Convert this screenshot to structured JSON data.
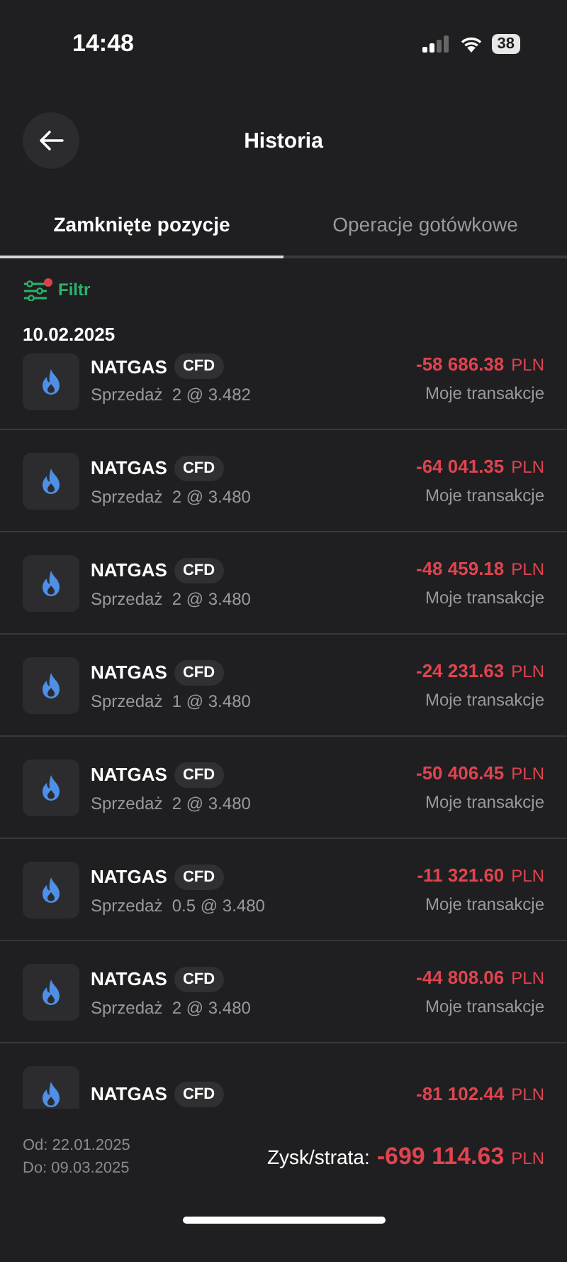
{
  "status_bar": {
    "time": "14:48",
    "battery": "38"
  },
  "header": {
    "title": "Historia"
  },
  "tabs": [
    {
      "label": "Zamknięte pozycje",
      "selected": true
    },
    {
      "label": "Operacje gotówkowe",
      "selected": false
    }
  ],
  "filter": {
    "label": "Filtr",
    "active": true
  },
  "date": "10.02.2025",
  "positions": [
    {
      "symbol": "NATGAS",
      "tag": "CFD",
      "detail": "Sprzedaż  2 @ 3.482",
      "amount": "-58 686.38",
      "currency": "PLN",
      "source": "Moje transakcje"
    },
    {
      "symbol": "NATGAS",
      "tag": "CFD",
      "detail": "Sprzedaż  2 @ 3.480",
      "amount": "-64 041.35",
      "currency": "PLN",
      "source": "Moje transakcje"
    },
    {
      "symbol": "NATGAS",
      "tag": "CFD",
      "detail": "Sprzedaż  2 @ 3.480",
      "amount": "-48 459.18",
      "currency": "PLN",
      "source": "Moje transakcje"
    },
    {
      "symbol": "NATGAS",
      "tag": "CFD",
      "detail": "Sprzedaż  1 @ 3.480",
      "amount": "-24 231.63",
      "currency": "PLN",
      "source": "Moje transakcje"
    },
    {
      "symbol": "NATGAS",
      "tag": "CFD",
      "detail": "Sprzedaż  2 @ 3.480",
      "amount": "-50 406.45",
      "currency": "PLN",
      "source": "Moje transakcje"
    },
    {
      "symbol": "NATGAS",
      "tag": "CFD",
      "detail": "Sprzedaż  0.5 @ 3.480",
      "amount": "-11 321.60",
      "currency": "PLN",
      "source": "Moje transakcje"
    },
    {
      "symbol": "NATGAS",
      "tag": "CFD",
      "detail": "Sprzedaż  2 @ 3.480",
      "amount": "-44 808.06",
      "currency": "PLN",
      "source": "Moje transakcje"
    },
    {
      "symbol": "NATGAS",
      "tag": "CFD",
      "amount": "-81 102.44",
      "currency": "PLN"
    }
  ],
  "footer": {
    "from": "Od: 22.01.2025",
    "to": "Do: 09.03.2025",
    "total_label": "Zysk/strata:",
    "total": "-699 114.63",
    "currency": "PLN"
  }
}
